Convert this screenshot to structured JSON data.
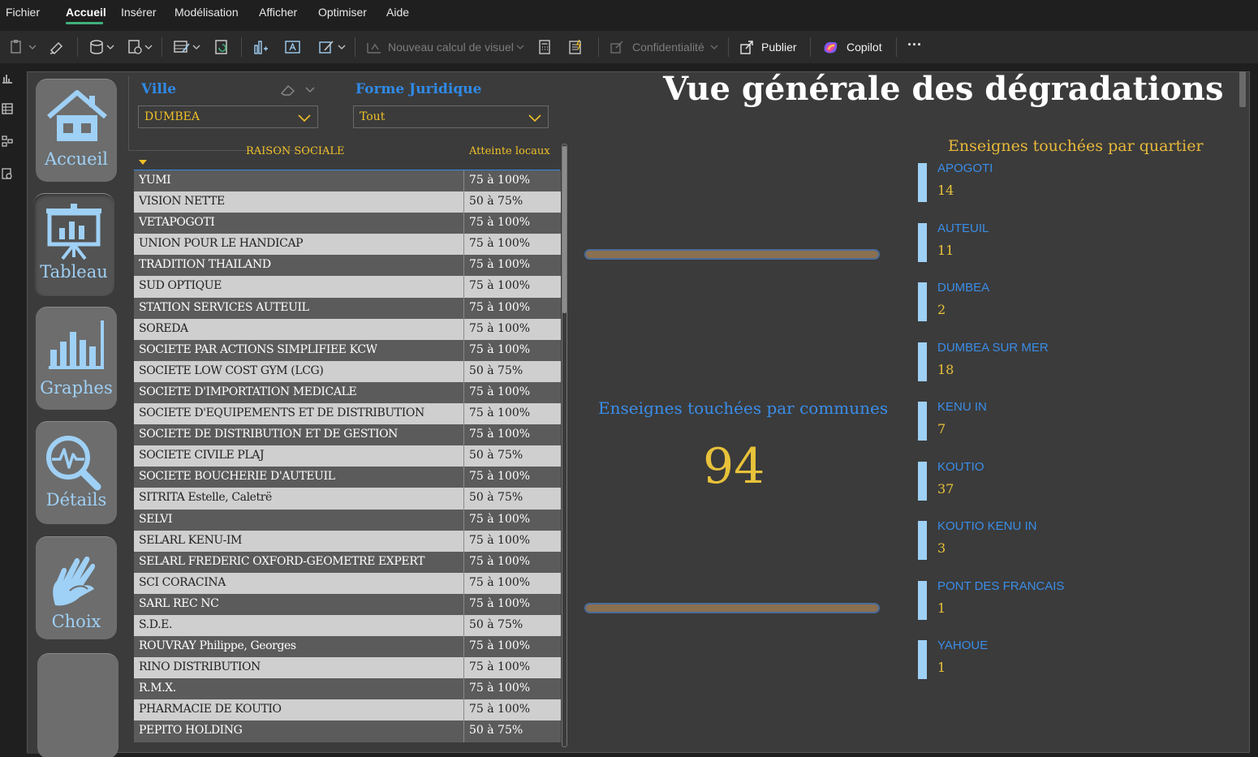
{
  "menu": {
    "items": [
      "Fichier",
      "Accueil",
      "Insérer",
      "Modélisation",
      "Afficher",
      "Optimiser",
      "Aide"
    ],
    "active": "Accueil"
  },
  "toolbar": {
    "new_visual_calc": "Nouveau calcul de visuel",
    "confidentiality": "Confidentialité",
    "publish": "Publier",
    "copilot": "Copilot",
    "more": "···"
  },
  "nav": {
    "home": "Accueil",
    "table": "Tableau",
    "charts": "Graphes",
    "details": "Détails",
    "choice": "Choix"
  },
  "slicers": {
    "city": {
      "title": "Ville",
      "value": "DUMBEA"
    },
    "legal_form": {
      "title": "Forme Juridique",
      "value": "Tout"
    }
  },
  "report": {
    "title": "Vue générale des dégradations"
  },
  "table": {
    "headers": {
      "name": "RAISON SOCIALE",
      "damage": "Atteinte locaux"
    },
    "rows": [
      {
        "name": "YUMI",
        "damage": "75 à 100%"
      },
      {
        "name": "VISION NETTE",
        "damage": "50 à 75%"
      },
      {
        "name": "VETAPOGOTI",
        "damage": "75 à 100%"
      },
      {
        "name": "UNION POUR LE HANDICAP",
        "damage": "75 à 100%"
      },
      {
        "name": "TRADITION THAILAND",
        "damage": "75 à 100%"
      },
      {
        "name": "SUD OPTIQUE",
        "damage": "75 à 100%"
      },
      {
        "name": "STATION SERVICES AUTEUIL",
        "damage": "75 à 100%"
      },
      {
        "name": "SOREDA",
        "damage": "75 à 100%"
      },
      {
        "name": "SOCIETE PAR ACTIONS SIMPLIFIEE KCW",
        "damage": "75 à 100%"
      },
      {
        "name": "SOCIETE LOW COST GYM (LCG)",
        "damage": "50 à 75%"
      },
      {
        "name": "SOCIETE D'IMPORTATION MEDICALE",
        "damage": "75 à 100%"
      },
      {
        "name": "SOCIETE D'EQUIPEMENTS ET DE DISTRIBUTION",
        "damage": "75 à 100%"
      },
      {
        "name": "SOCIETE DE DISTRIBUTION ET DE GESTION",
        "damage": "75 à 100%"
      },
      {
        "name": "SOCIETE CIVILE PLAJ",
        "damage": "50 à 75%"
      },
      {
        "name": "SOCIETE BOUCHERIE D'AUTEUIL",
        "damage": "75 à 100%"
      },
      {
        "name": "SITRITA Estelle, Caletrë",
        "damage": "50 à 75%"
      },
      {
        "name": "SELVI",
        "damage": "75 à 100%"
      },
      {
        "name": "SELARL KENU-IM",
        "damage": "75 à 100%"
      },
      {
        "name": "SELARL FREDERIC OXFORD-GEOMETRE EXPERT",
        "damage": "75 à 100%"
      },
      {
        "name": "SCI CORACINA",
        "damage": "75 à 100%"
      },
      {
        "name": "SARL REC NC",
        "damage": "75 à 100%"
      },
      {
        "name": "S.D.E.",
        "damage": "50 à 75%"
      },
      {
        "name": "ROUVRAY Philippe, Georges",
        "damage": "75 à 100%"
      },
      {
        "name": "RINO DISTRIBUTION",
        "damage": "75 à 100%"
      },
      {
        "name": "R.M.X.",
        "damage": "75 à 100%"
      },
      {
        "name": "PHARMACIE DE KOUTIO",
        "damage": "75 à 100%"
      },
      {
        "name": "PEPITO HOLDING",
        "damage": "50 à 75%"
      }
    ]
  },
  "card": {
    "label": "Enseignes touchées par communes",
    "value": "94"
  },
  "districts": {
    "title": "Enseignes touchées par quartier",
    "items": [
      {
        "name": "APOGOTI",
        "count": "14"
      },
      {
        "name": "AUTEUIL",
        "count": "11"
      },
      {
        "name": "DUMBEA",
        "count": "2"
      },
      {
        "name": "DUMBEA SUR MER",
        "count": "18"
      },
      {
        "name": "KENU IN",
        "count": "7"
      },
      {
        "name": "KOUTIO",
        "count": "37"
      },
      {
        "name": "KOUTIO KENU IN",
        "count": "3"
      },
      {
        "name": "PONT DES FRANCAIS",
        "count": "1"
      },
      {
        "name": "YAHOUE",
        "count": "1"
      }
    ]
  },
  "colors": {
    "accent_blue": "#2f8ae8",
    "gold": "#f0c028",
    "light_blue": "#9fd0f5",
    "canvas": "#3b3b3b"
  }
}
